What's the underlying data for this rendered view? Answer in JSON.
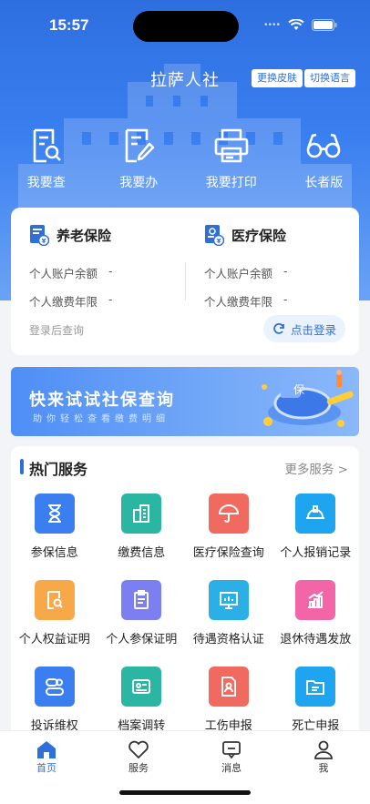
{
  "status": {
    "time": "15:57"
  },
  "header": {
    "title": "拉萨人社",
    "skin_label": "更换皮肤",
    "lang_label": "切换语言"
  },
  "quick": [
    {
      "label": "我要查",
      "icon": "search-doc-icon"
    },
    {
      "label": "我要办",
      "icon": "edit-doc-icon"
    },
    {
      "label": "我要打印",
      "icon": "printer-icon"
    },
    {
      "label": "长者版",
      "icon": "glasses-icon"
    }
  ],
  "insurance": {
    "pension": {
      "title": "养老保险",
      "balance_label": "个人账户余额",
      "balance_value": "-",
      "years_label": "个人缴费年限",
      "years_value": "-"
    },
    "medical": {
      "title": "医疗保险",
      "balance_label": "个人账户余额",
      "balance_value": "-",
      "years_label": "个人缴费年限",
      "years_value": "-"
    },
    "login_hint": "登录后查询",
    "login_button": "点击登录"
  },
  "banner": {
    "title": "快来试试社保查询",
    "subtitle": "助你轻松查看缴费明细",
    "badge": "保"
  },
  "services": {
    "title": "热门服务",
    "more": "更多服务 >",
    "items": [
      {
        "label": "参保信息",
        "icon": "hourglass-icon",
        "color": "#3b7ef0"
      },
      {
        "label": "缴费信息",
        "icon": "building-icon",
        "color": "#2bb5a3"
      },
      {
        "label": "医疗保险查询",
        "icon": "umbrella-icon",
        "color": "#f06a5f"
      },
      {
        "label": "个人报销记录",
        "icon": "helmet-icon",
        "color": "#1fa4ef"
      },
      {
        "label": "个人权益证明",
        "icon": "search-doc-icon",
        "color": "#f7a94a"
      },
      {
        "label": "个人参保证明",
        "icon": "clipboard-icon",
        "color": "#7b7ff2"
      },
      {
        "label": "待遇资格认证",
        "icon": "monitor-icon",
        "color": "#2ab0e6"
      },
      {
        "label": "退休待遇发放",
        "icon": "chart-up-icon",
        "color": "#f266a8"
      },
      {
        "label": "投诉维权",
        "icon": "toggle-icon",
        "color": "#3b7ef0"
      },
      {
        "label": "档案调转",
        "icon": "id-card-icon",
        "color": "#2bb5a3"
      },
      {
        "label": "工伤申报",
        "icon": "person-doc-icon",
        "color": "#f06a5f"
      },
      {
        "label": "死亡申报",
        "icon": "folder-doc-icon",
        "color": "#1fa4ef"
      }
    ]
  },
  "tabs": [
    {
      "label": "首页",
      "icon": "home-icon",
      "active": true
    },
    {
      "label": "服务",
      "icon": "heart-icon",
      "active": false
    },
    {
      "label": "消息",
      "icon": "message-icon",
      "active": false
    },
    {
      "label": "我",
      "icon": "user-icon",
      "active": false
    }
  ],
  "colors": {
    "primary": "#2f6fd8",
    "hero": "#3a7ff0"
  }
}
